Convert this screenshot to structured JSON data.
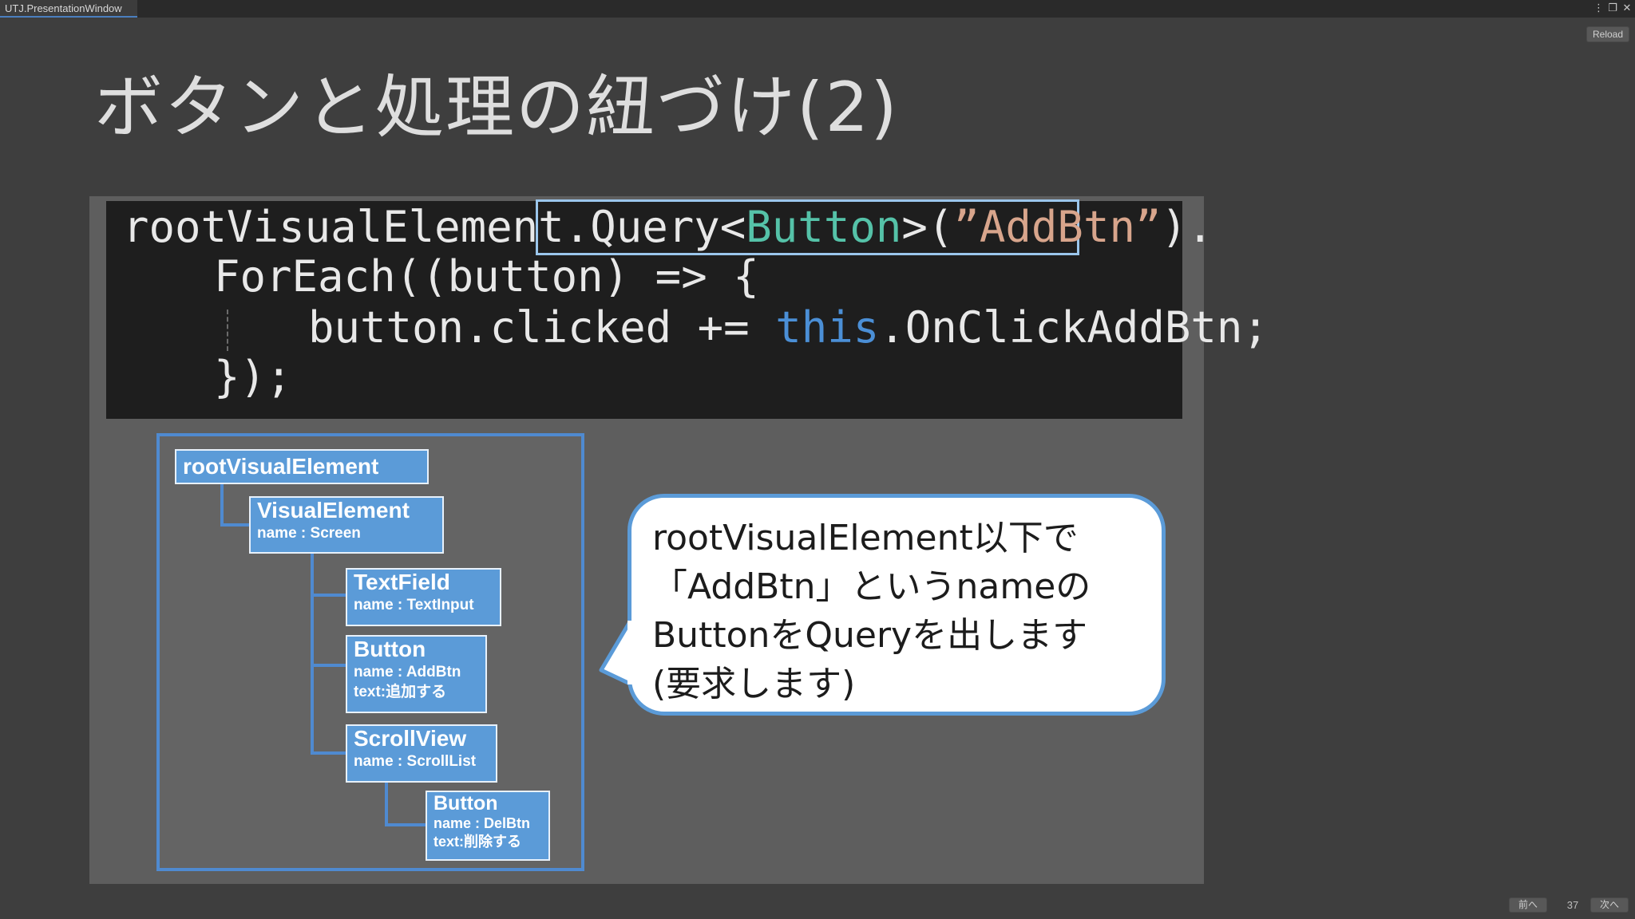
{
  "window": {
    "tab_title": "UTJ.PresentationWindow",
    "menu_icon": "⋮",
    "maximize_icon": "❐",
    "close_icon": "✕",
    "reload_label": "Reload"
  },
  "slide": {
    "title": "ボタンと処理の紐づけ(2)",
    "code": {
      "line1_prefix": "rootVisualElement.",
      "line1_query": "Query<",
      "line1_type": "Button",
      "line1_paren_open": ">(",
      "line1_string": "”AddBtn”",
      "line1_paren_close": ")",
      "line1_dot": ".",
      "line2": "ForEach((button) => {",
      "line3_prefix": "button.clicked += ",
      "line3_this": "this",
      "line3_suffix": ".OnClickAddBtn;",
      "line4": "});"
    },
    "tree": {
      "root": "rootVisualElement",
      "visual_element": {
        "type": "VisualElement",
        "name": "name : Screen"
      },
      "text_field": {
        "type": "TextField",
        "name": "name : TextInput"
      },
      "add_button": {
        "type": "Button",
        "name": "name : AddBtn",
        "text": "text:追加する"
      },
      "scroll_view": {
        "type": "ScrollView",
        "name": "name : ScrollList"
      },
      "del_button": {
        "type": "Button",
        "name": "name : DelBtn",
        "text": "text:削除する"
      }
    },
    "callout": {
      "line1": "rootVisualElement以下で",
      "line2": "「AddBtn」というnameの",
      "line3": "ButtonをQueryを出します",
      "line4": "(要求します)"
    }
  },
  "footer": {
    "prev_label": "前へ",
    "page_number": "37",
    "next_label": "次へ"
  },
  "colors": {
    "background": "#3e3e3e",
    "code_background": "#1e1e1e",
    "type_color": "#55c2a8",
    "string_color": "#d8a58c",
    "keyword_this_color": "#4b8fd6",
    "node_fill": "#5b9bd8",
    "accent_blue": "#4f8ad0"
  }
}
